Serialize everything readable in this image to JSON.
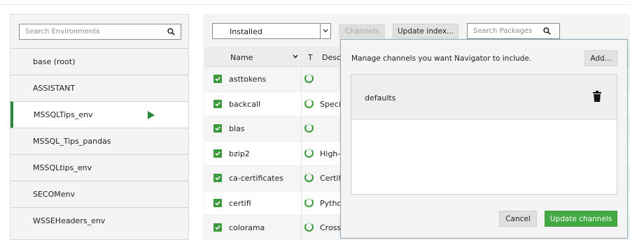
{
  "environments": {
    "search_placeholder": "Search Environments",
    "items": [
      {
        "label": "base (root)"
      },
      {
        "label": "ASSISTANT"
      },
      {
        "label": "MSSQLTips_env"
      },
      {
        "label": "MSSQL_Tips_pandas"
      },
      {
        "label": "MSSQLtips_env"
      },
      {
        "label": "SECOMenv"
      },
      {
        "label": "WSSEHeaders_env"
      }
    ],
    "active": "MSSQLTips_env"
  },
  "toolbar": {
    "filter_value": "Installed",
    "channels_label": "Channels",
    "update_index_label": "Update index...",
    "search_packages_placeholder": "Search Packages"
  },
  "table": {
    "col_name": "Name",
    "col_t": "T",
    "col_desc": "Descr",
    "rows": [
      {
        "name": "asttokens",
        "desc": ""
      },
      {
        "name": "backcall",
        "desc": "Specif"
      },
      {
        "name": "blas",
        "desc": ""
      },
      {
        "name": "bzip2",
        "desc": "High-q"
      },
      {
        "name": "ca-certificates",
        "desc": "Certif"
      },
      {
        "name": "certifi",
        "desc": "Pytho"
      },
      {
        "name": "colorama",
        "desc": "Cross-"
      }
    ]
  },
  "dialog": {
    "message": "Manage channels you want Navigator to include.",
    "add_label": "Add...",
    "channels": [
      {
        "name": "defaults"
      }
    ],
    "cancel_label": "Cancel",
    "update_label": "Update channels"
  },
  "colors": {
    "accent_green": "#43a943",
    "active_border": "#2b8a3e"
  }
}
